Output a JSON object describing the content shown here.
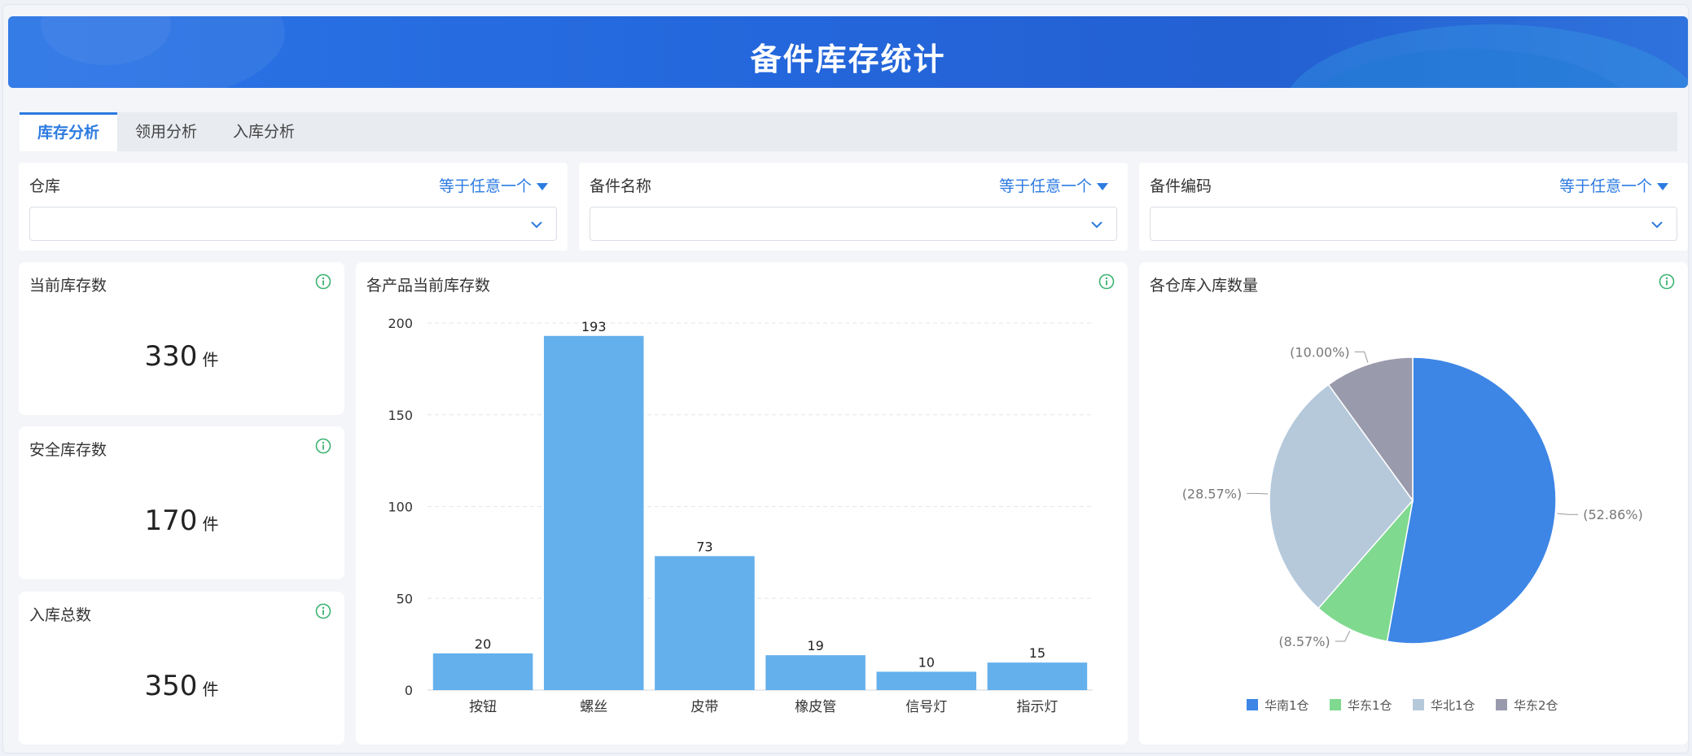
{
  "header": {
    "title": "备件库存统计"
  },
  "tabs": [
    {
      "label": "库存分析",
      "active": true
    },
    {
      "label": "领用分析",
      "active": false
    },
    {
      "label": "入库分析",
      "active": false
    }
  ],
  "filters": [
    {
      "label": "仓库",
      "operator": "等于任意一个",
      "value": ""
    },
    {
      "label": "备件名称",
      "operator": "等于任意一个",
      "value": ""
    },
    {
      "label": "备件编码",
      "operator": "等于任意一个",
      "value": ""
    }
  ],
  "metrics": [
    {
      "title": "当前库存数",
      "value": "330",
      "unit": "件"
    },
    {
      "title": "安全库存数",
      "value": "170",
      "unit": "件"
    },
    {
      "title": "入库总数",
      "value": "350",
      "unit": "件"
    }
  ],
  "bar_card": {
    "title": "各产品当前库存数"
  },
  "pie_card": {
    "title": "各仓库入库数量"
  },
  "colors": {
    "accent": "#2c7be0",
    "bar": "#64b0ec",
    "info_icon": "#3cb371"
  },
  "chart_data": [
    {
      "type": "bar",
      "title": "各产品当前库存数",
      "categories": [
        "按钮",
        "螺丝",
        "皮带",
        "橡皮管",
        "信号灯",
        "指示灯"
      ],
      "values": [
        20,
        193,
        73,
        19,
        10,
        15
      ],
      "ylim": [
        0,
        200
      ],
      "yticks": [
        0,
        50,
        100,
        150,
        200
      ],
      "grid": true,
      "data_labels": true
    },
    {
      "type": "pie",
      "title": "各仓库入库数量",
      "legend_position": "bottom",
      "slices": [
        {
          "name": "华南1仓",
          "percent": 52.86,
          "label": "(52.86%)",
          "color": "#3d86e6"
        },
        {
          "name": "华东1仓",
          "percent": 8.57,
          "label": "(8.57%)",
          "color": "#7fd98f"
        },
        {
          "name": "华北1仓",
          "percent": 28.57,
          "label": "(28.57%)",
          "color": "#b5c9db"
        },
        {
          "name": "华东2仓",
          "percent": 10.0,
          "label": "(10.00%)",
          "color": "#9a9aad"
        }
      ]
    }
  ]
}
